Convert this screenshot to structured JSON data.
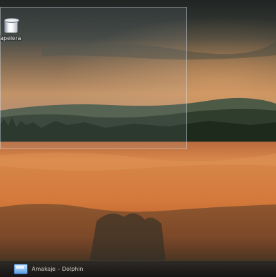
{
  "desktop": {
    "icons": [
      {
        "label": "Papelera",
        "icon": "trash-bin-icon"
      }
    ]
  },
  "taskbar": {
    "tasks": [
      {
        "label": "Amakaje – Dolphin",
        "icon": "dolphin-window-icon"
      }
    ]
  },
  "colors": {
    "sky_dark": "#2a2d2c",
    "sky_glow": "#b88454",
    "hills": "#3c4a38",
    "field": "#d5783a",
    "taskbar": "#151210"
  }
}
